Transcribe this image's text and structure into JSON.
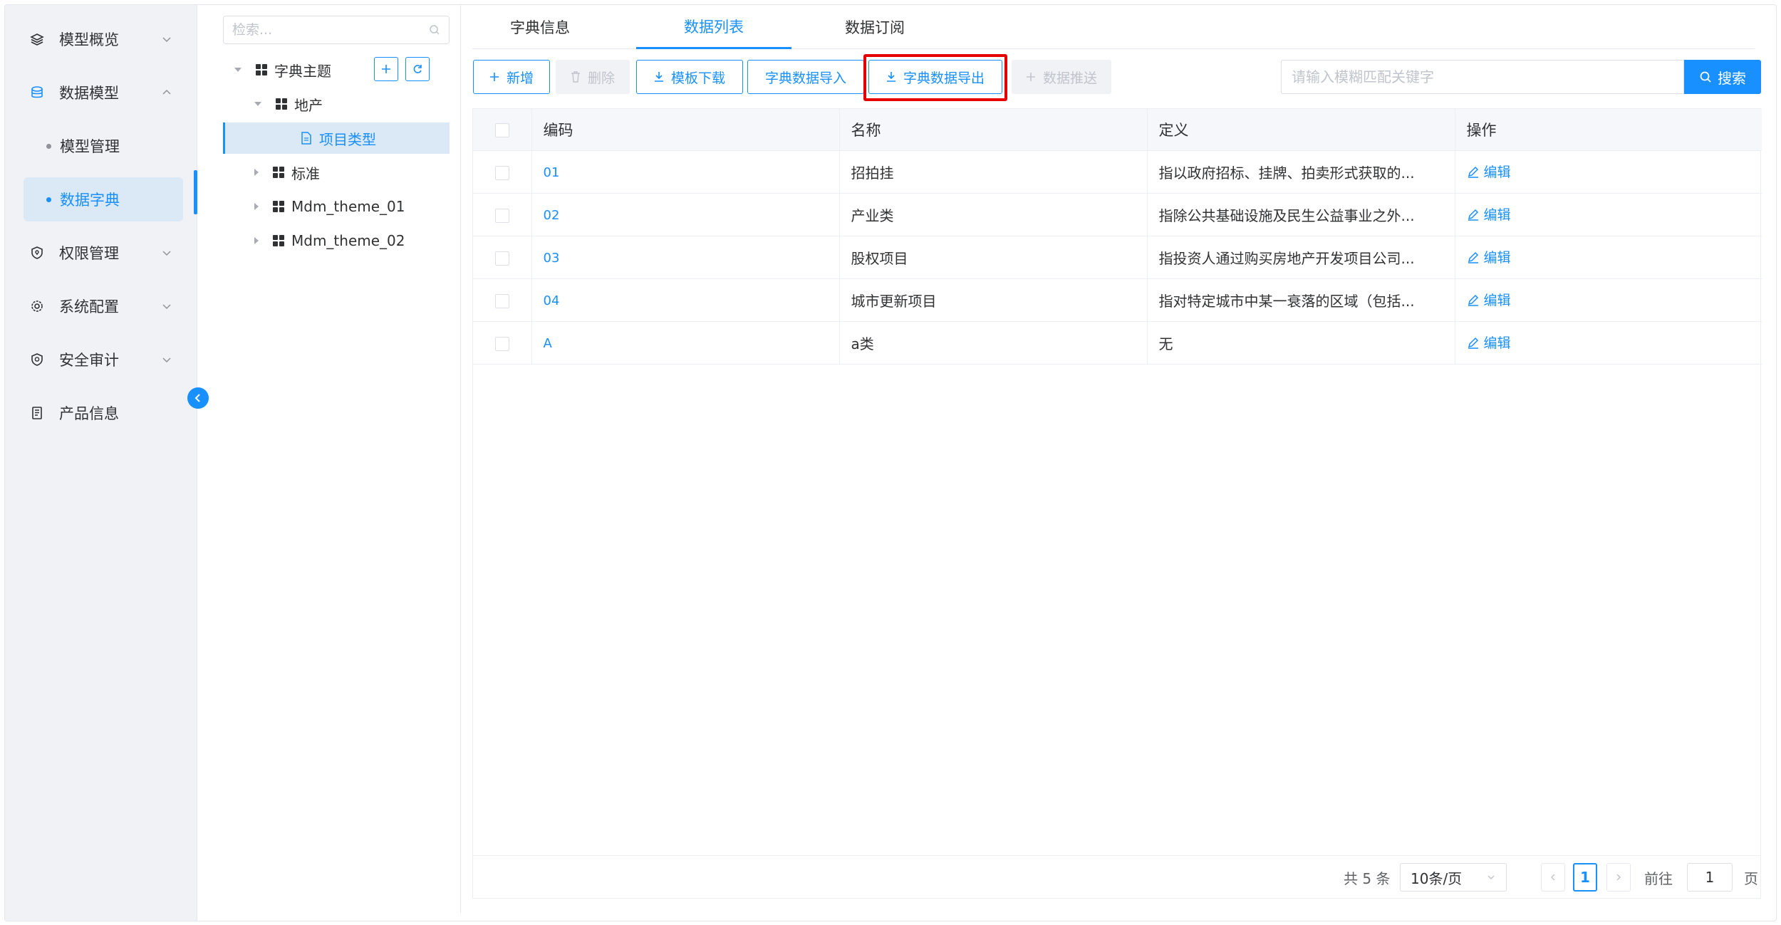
{
  "sidebar": {
    "items": [
      {
        "label": "模型概览",
        "icon": "layers-icon"
      },
      {
        "label": "数据模型",
        "icon": "database-icon"
      },
      {
        "label": "权限管理",
        "icon": "shield-icon"
      },
      {
        "label": "系统配置",
        "icon": "cog-icon"
      },
      {
        "label": "安全审计",
        "icon": "audit-icon"
      },
      {
        "label": "产品信息",
        "icon": "document-icon"
      }
    ],
    "sub_items": [
      {
        "label": "模型管理"
      },
      {
        "label": "数据字典"
      }
    ]
  },
  "tree": {
    "search_placeholder": "检索...",
    "nodes": [
      {
        "label": "字典主题"
      },
      {
        "label": "地产"
      },
      {
        "label": "项目类型"
      },
      {
        "label": "标准"
      },
      {
        "label": "Mdm_theme_01"
      },
      {
        "label": "Mdm_theme_02"
      }
    ]
  },
  "tabs": [
    {
      "label": "字典信息"
    },
    {
      "label": "数据列表"
    },
    {
      "label": "数据订阅"
    }
  ],
  "toolbar": {
    "add": "新增",
    "delete": "删除",
    "template_download": "模板下载",
    "import": "字典数据导入",
    "export": "字典数据导出",
    "push": "数据推送",
    "search_placeholder": "请输入模糊匹配关键字",
    "search": "搜索"
  },
  "table": {
    "headers": [
      "编码",
      "名称",
      "定义",
      "操作"
    ],
    "rows": [
      {
        "code": "01",
        "name": "招拍挂",
        "definition": "指以政府招标、挂牌、拍卖形式获取的...",
        "action": "编辑"
      },
      {
        "code": "02",
        "name": "产业类",
        "definition": "指除公共基础设施及民生公益事业之外...",
        "action": "编辑"
      },
      {
        "code": "03",
        "name": "股权项目",
        "definition": "指投资人通过购买房地产开发项目公司...",
        "action": "编辑"
      },
      {
        "code": "04",
        "name": "城市更新项目",
        "definition": "指对特定城市中某一衰落的区域（包括...",
        "action": "编辑"
      },
      {
        "code": "A",
        "name": "a类",
        "definition": "无",
        "action": "编辑"
      }
    ]
  },
  "pagination": {
    "total": "共 5 条",
    "page_size": "10条/页",
    "current_page": "1",
    "goto_label": "前往",
    "goto_value": "1",
    "page_suffix": "页"
  },
  "colors": {
    "primary": "#1890ff",
    "highlight": "#e60000",
    "sidebar_bg": "#f0f2f5"
  }
}
